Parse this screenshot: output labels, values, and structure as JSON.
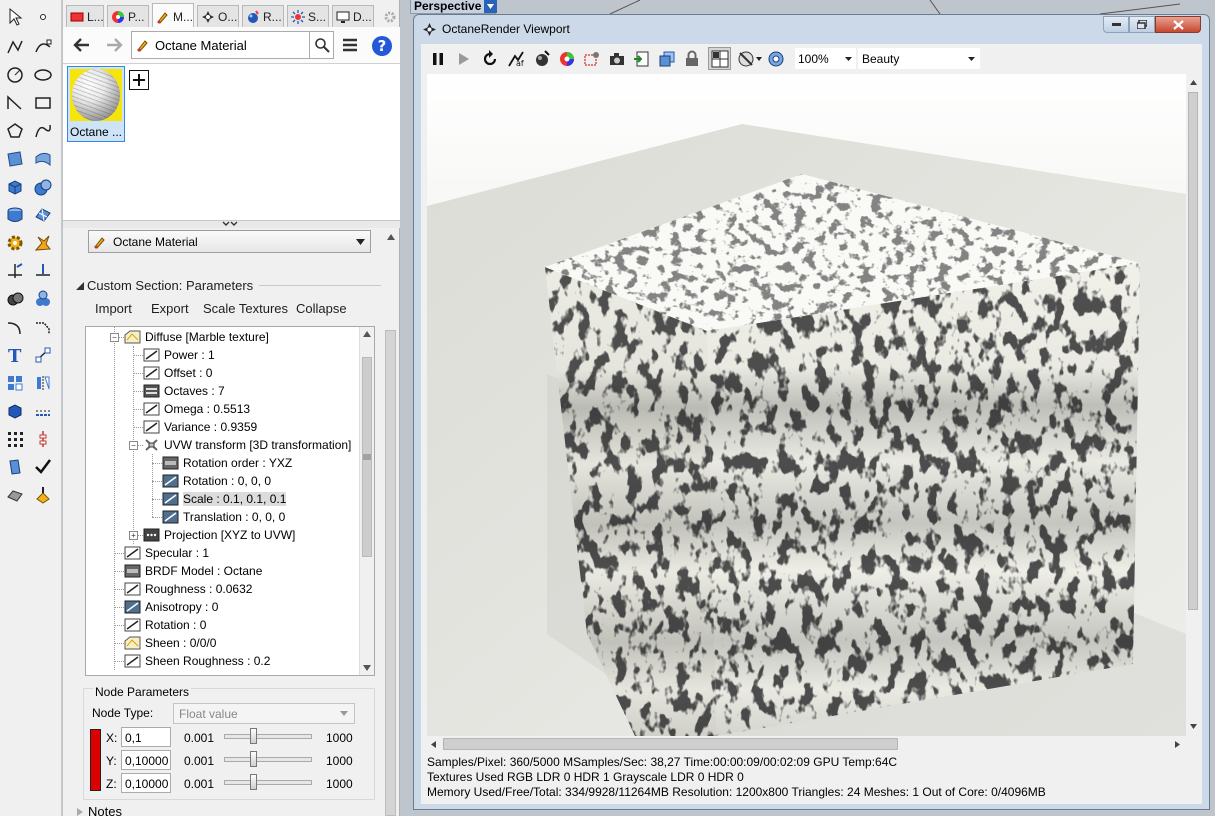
{
  "left_panel": {
    "tabs": [
      {
        "label": "L...",
        "icon": "layers-icon"
      },
      {
        "label": "P...",
        "icon": "color-wheel-icon"
      },
      {
        "label": "M...",
        "icon": "material-brush-icon"
      },
      {
        "label": "O...",
        "icon": "octane-icon"
      },
      {
        "label": "R...",
        "icon": "render-sphere-icon"
      },
      {
        "label": "S...",
        "icon": "sun-icon"
      },
      {
        "label": "D...",
        "icon": "display-icon"
      }
    ],
    "breadcrumb": "Octane Material",
    "thumbnail_label": "Octane ...",
    "material_dropdown": "Octane Material",
    "custom_section_title": "Custom Section: Parameters",
    "buttons": {
      "import": "Import",
      "export": "Export",
      "scale_textures": "Scale Textures",
      "collapse": "Collapse"
    },
    "tree": [
      {
        "label": "Diffuse  [Marble texture]",
        "icon": "texture-icon"
      },
      {
        "label": "Power : 1",
        "icon": "float-icon"
      },
      {
        "label": "Offset : 0",
        "icon": "float-icon"
      },
      {
        "label": "Octaves : 7",
        "icon": "int-icon"
      },
      {
        "label": "Omega : 0.5513",
        "icon": "float-icon"
      },
      {
        "label": "Variance : 0.9359",
        "icon": "float-icon"
      },
      {
        "label": "UVW transform  [3D transformation]",
        "icon": "transform-icon"
      },
      {
        "label": "Rotation order : YXZ",
        "icon": "enum-icon"
      },
      {
        "label": "Rotation : 0, 0, 0",
        "icon": "vector-icon"
      },
      {
        "label": "Scale : 0.1, 0.1, 0.1",
        "icon": "vector-icon"
      },
      {
        "label": "Translation : 0, 0, 0",
        "icon": "vector-icon"
      },
      {
        "label": "Projection  [XYZ to UVW]",
        "icon": "projection-icon"
      },
      {
        "label": "Specular : 1",
        "icon": "float-icon"
      },
      {
        "label": "BRDF Model : Octane",
        "icon": "enum-icon"
      },
      {
        "label": "Roughness : 0.0632",
        "icon": "float-icon"
      },
      {
        "label": "Anisotropy : 0",
        "icon": "vector-icon"
      },
      {
        "label": "Rotation : 0",
        "icon": "float-icon"
      },
      {
        "label": "Sheen : 0/0/0",
        "icon": "texture-icon"
      },
      {
        "label": "Sheen Roughness : 0.2",
        "icon": "float-icon"
      }
    ],
    "node_params": {
      "title": "Node Parameters",
      "type_label": "Node Type:",
      "type_value": "Float value",
      "rows": [
        {
          "axis": "X:",
          "value": "0,1",
          "min": "0.001",
          "max": "1000"
        },
        {
          "axis": "Y:",
          "value": "0,10000",
          "min": "0.001",
          "max": "1000"
        },
        {
          "axis": "Z:",
          "value": "0,10000",
          "min": "0.001",
          "max": "1000"
        }
      ]
    },
    "notes_label": "Notes"
  },
  "viewport_label": "Perspective",
  "render_window": {
    "title": "OctaneRender Viewport",
    "zoom": "100%",
    "pass": "Beauty",
    "status_lines": [
      "Samples/Pixel: 360/5000   MSamples/Sec: 38,27   Time:00:00:09/00:02:09   GPU Temp:64C",
      "Textures Used RGB LDR 0   HDR 1   Grayscale LDR 0   HDR 0",
      "Memory Used/Free/Total: 334/9928/11264MB   Resolution: 1200x800   Triangles: 24   Meshes: 1 Out of Core: 0/4096MB"
    ]
  }
}
